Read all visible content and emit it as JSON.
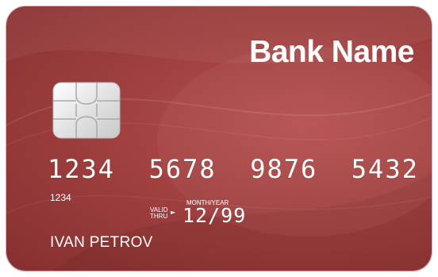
{
  "card": {
    "bank_name": "Bank Name",
    "card_number": "1234  5678  9876  5432",
    "number_short": "1234",
    "valid_label_line1": "VALID",
    "valid_label_line2": "THRU",
    "month_year_label": "MONTH/YEAR",
    "expiry": "12/99",
    "holder_name": "IVAN PETROV"
  },
  "colors": {
    "card_base": "#a0403f",
    "card_dark": "#862f30",
    "text": "#ffffff",
    "chip": "#e8e8e8"
  },
  "icons": {
    "chip": "emv-chip-icon"
  }
}
